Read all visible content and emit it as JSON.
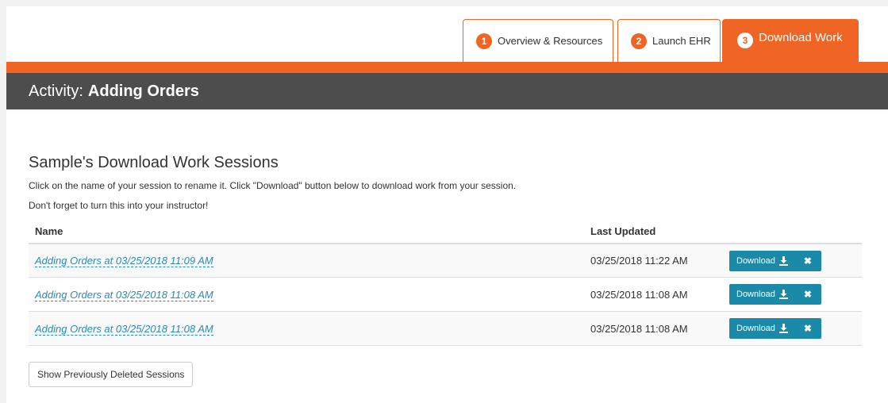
{
  "tabs": [
    {
      "num": "1",
      "label": "Overview & Resources"
    },
    {
      "num": "2",
      "label": "Launch EHR"
    },
    {
      "num": "3",
      "label": "Download Work"
    }
  ],
  "activity": {
    "prefix": "Activity:",
    "name": "Adding Orders"
  },
  "section": {
    "title": "Sample's Download Work Sessions",
    "info1": "Click on the name of your session to rename it. Click \"Download\" button below to download work from your session.",
    "info2": "Don't forget to turn this into your instructor!"
  },
  "table": {
    "headers": {
      "name": "Name",
      "updated": "Last Updated"
    },
    "rows": [
      {
        "name": "Adding Orders at 03/25/2018 11:09 AM",
        "updated": "03/25/2018 11:22 AM"
      },
      {
        "name": "Adding Orders at 03/25/2018 11:08 AM",
        "updated": "03/25/2018 11:08 AM"
      },
      {
        "name": "Adding Orders at 03/25/2018 11:08 AM",
        "updated": "03/25/2018 11:08 AM"
      }
    ],
    "download_label": "Download",
    "delete_glyph": "✖"
  },
  "show_deleted_label": "Show Previously Deleted Sessions",
  "colors": {
    "accent": "#f06424",
    "header_bar": "#4d4d4d",
    "button": "#1a8aa8",
    "link": "#2a8ab4"
  }
}
